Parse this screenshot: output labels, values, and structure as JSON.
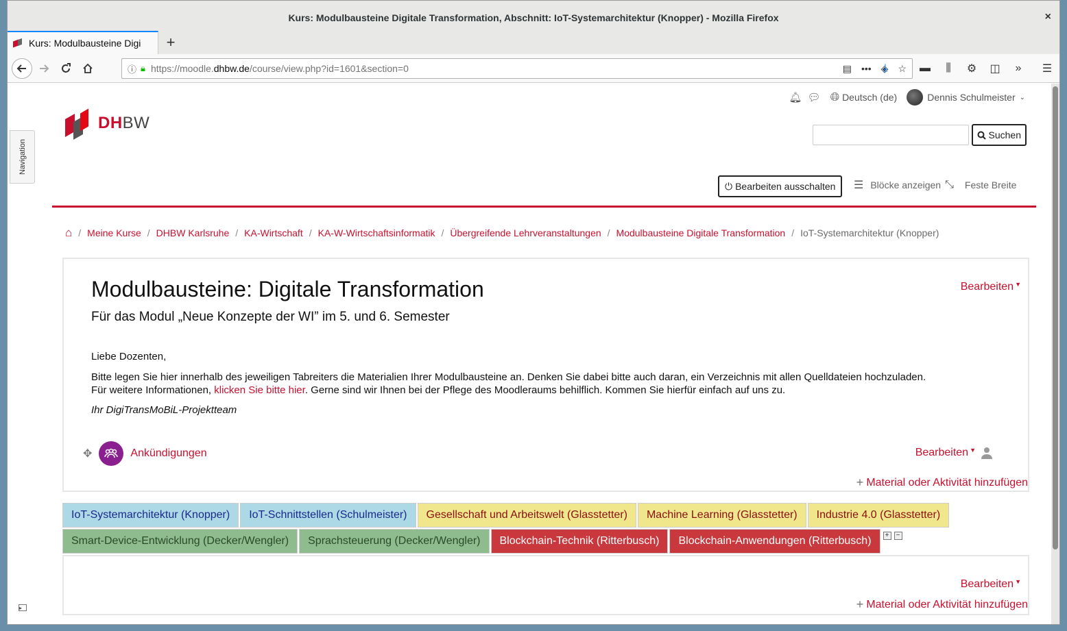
{
  "window": {
    "title": "Kurs: Modulbausteine Digitale Transformation, Abschnitt: IoT-Systemarchitektur (Knopper) - Mozilla Firefox",
    "close": "×"
  },
  "browser": {
    "tab_title": "Kurs: Modulbausteine Digi",
    "tab_close": "×",
    "newtab": "+",
    "url_prefix": "https://moodle.",
    "url_domain": "dhbw.de",
    "url_path": "/course/view.php?id=1601&section=0"
  },
  "page": {
    "navigation_tab": "Navigation",
    "logo": {
      "dh": "DH",
      "bw": "BW"
    },
    "language": "Deutsch (de)",
    "user_name": "Dennis Schulmeister",
    "search_button": "Suchen",
    "edit_toggle": "Bearbeiten ausschalten",
    "show_blocks": "Blöcke anzeigen",
    "fixed_width": "Feste Breite",
    "breadcrumb": [
      "Meine Kurse",
      "DHBW Karlsruhe",
      "KA-Wirtschaft",
      "KA-W-Wirtschaftsinformatik",
      "Übergreifende Lehrveranstaltungen",
      "Modulbausteine Digitale Transformation"
    ],
    "breadcrumb_current": "IoT-Systemarchitektur (Knopper)",
    "section0": {
      "title": "Modulbausteine: Digitale Transformation",
      "subtitle": "Für das Modul „Neue Konzepte der WI” im 5. und 6. Semester",
      "greeting": "Liebe Dozenten,",
      "text_a": "Bitte legen Sie hier innerhalb des jeweiligen Tabreiters die Materialien Ihrer Modulbausteine an. Denken Sie dabei bitte auch daran, ein Verzeichnis mit allen Quelldateien hochzuladen. Für weitere Informationen, ",
      "link": "klicken Sie bitte hier",
      "text_b": ". Gerne sind wir Ihnen bei der Pflege des Moodleraums behilflich. Kommen Sie hierfür einfach auf uns zu.",
      "signature": "Ihr DigiTransMoBiL-Projektteam",
      "edit": "Bearbeiten",
      "activity": "Ankündigungen",
      "activity_edit": "Bearbeiten",
      "add": "Material oder Aktivität hinzufügen"
    },
    "tabs_row1": [
      {
        "label": "IoT-Systemarchitektur (Knopper)",
        "color": "#add8e6"
      },
      {
        "label": "IoT-Schnittstellen (Schulmeister)",
        "color": "#add8e6"
      },
      {
        "label": "Gesellschaft und Arbeitswelt (Glasstetter)",
        "color": "#f0e68c"
      },
      {
        "label": "Machine Learning (Glasstetter)",
        "color": "#f0e68c"
      },
      {
        "label": "Industrie 4.0 (Glasstetter)",
        "color": "#f0e68c"
      }
    ],
    "tabs_row2": [
      {
        "label": "Smart-Device-Entwicklung (Decker/Wengler)",
        "color": "#8fbc8f"
      },
      {
        "label": "Sprachsteuerung (Decker/Wengler)",
        "color": "#8fbc8f"
      },
      {
        "label": "Blockchain-Technik (Ritterbusch)",
        "color": "#c8383d"
      },
      {
        "label": "Blockchain-Anwendungen (Ritterbusch)",
        "color": "#c8383d"
      }
    ],
    "tabpanel": {
      "edit": "Bearbeiten",
      "add": "Material oder Aktivität hinzufügen"
    }
  }
}
